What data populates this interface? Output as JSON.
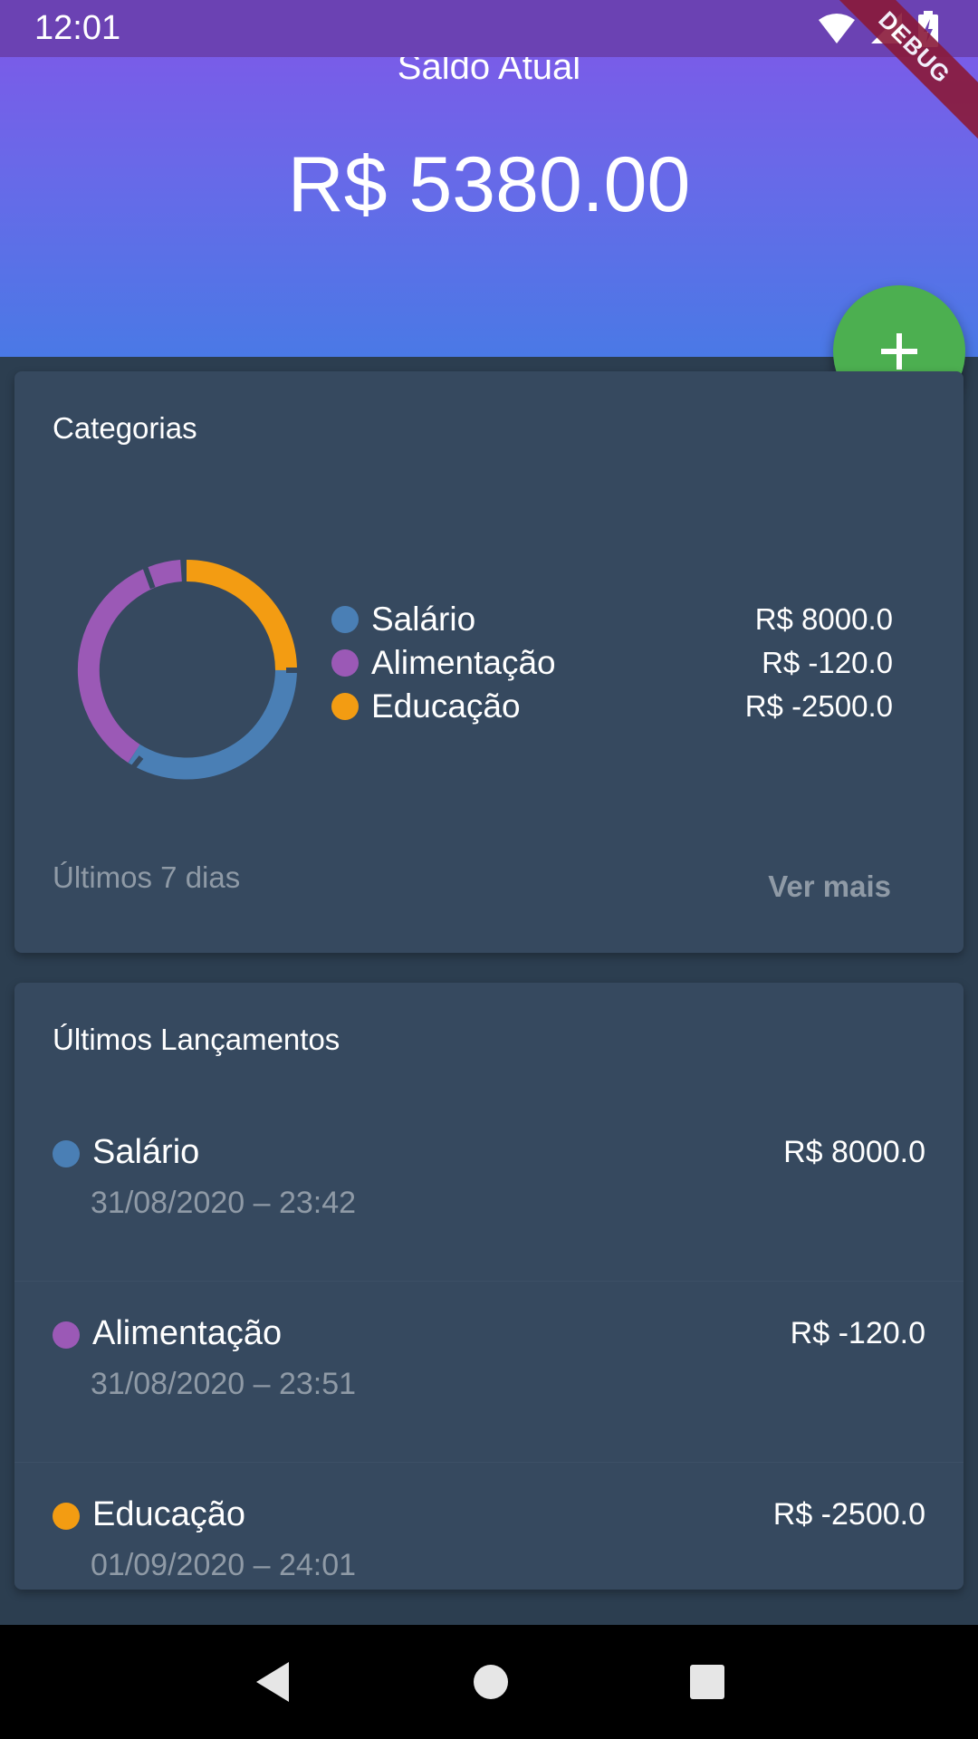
{
  "status_bar": {
    "time": "12:01",
    "debug_label": "DEBUG"
  },
  "header": {
    "balance_label": "Saldo Atual",
    "balance_value": "R$ 5380.00"
  },
  "fab": {
    "label": "+"
  },
  "categorias": {
    "title": "Categorias",
    "items": [
      {
        "name": "Salário",
        "value": "R$ 8000.0",
        "color": "#4a7fb5"
      },
      {
        "name": "Alimentação",
        "value": "R$ -120.0",
        "color": "#9b59b6"
      },
      {
        "name": "Educação",
        "value": "R$ -2500.0",
        "color": "#f39c12"
      }
    ],
    "footer": "Últimos 7 dias",
    "ver_mais": "Ver mais"
  },
  "lancamentos": {
    "title": "Últimos Lançamentos",
    "items": [
      {
        "name": "Salário",
        "date": "31/08/2020 – 23:42",
        "value": "R$ 8000.0",
        "color": "#4a7fb5"
      },
      {
        "name": "Alimentação",
        "date": "31/08/2020 – 23:51",
        "value": "R$ -120.0",
        "color": "#9b59b6"
      },
      {
        "name": "Educação",
        "date": "01/09/2020 – 24:01",
        "value": "R$ -2500.0",
        "color": "#f39c12"
      }
    ]
  }
}
